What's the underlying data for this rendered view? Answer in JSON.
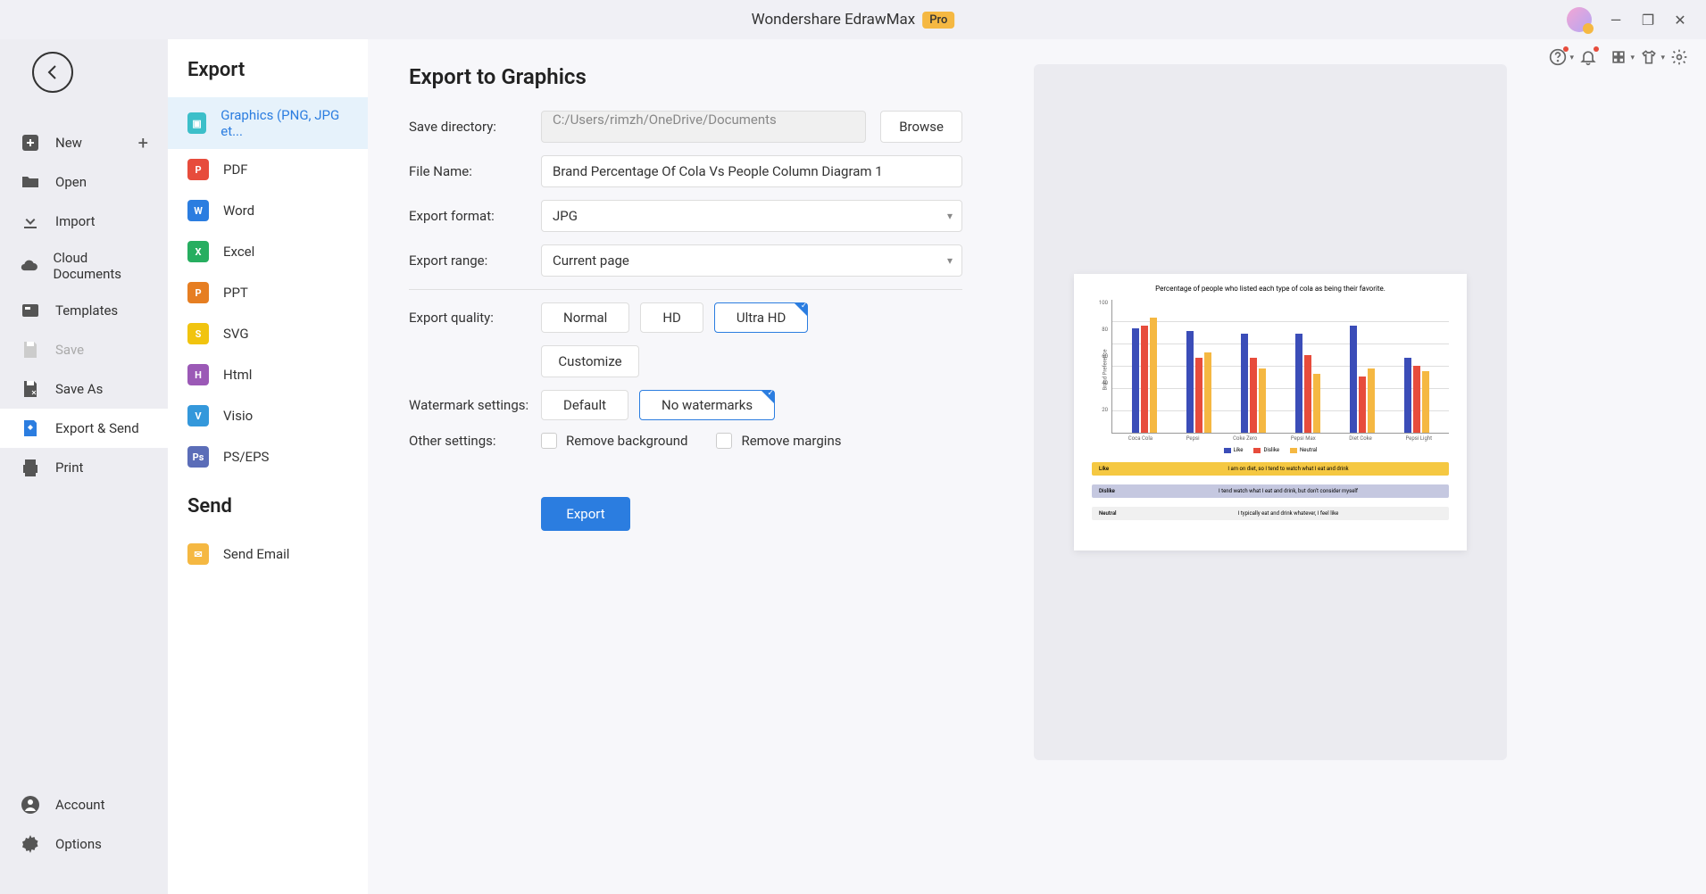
{
  "titlebar": {
    "app_name": "Wondershare EdrawMax",
    "pro_badge": "Pro"
  },
  "sidebar_left": {
    "items": [
      {
        "label": "New"
      },
      {
        "label": "Open"
      },
      {
        "label": "Import"
      },
      {
        "label": "Cloud Documents"
      },
      {
        "label": "Templates"
      },
      {
        "label": "Save"
      },
      {
        "label": "Save As"
      },
      {
        "label": "Export & Send"
      },
      {
        "label": "Print"
      }
    ],
    "bottom": [
      {
        "label": "Account"
      },
      {
        "label": "Options"
      }
    ]
  },
  "sidebar_mid": {
    "export_header": "Export",
    "export_items": [
      {
        "label": "Graphics (PNG, JPG et...",
        "color": "#3cbfc9"
      },
      {
        "label": "PDF",
        "color": "#e74c3c"
      },
      {
        "label": "Word",
        "color": "#2b7de0"
      },
      {
        "label": "Excel",
        "color": "#27ae60"
      },
      {
        "label": "PPT",
        "color": "#e67e22"
      },
      {
        "label": "SVG",
        "color": "#f1c40f"
      },
      {
        "label": "Html",
        "color": "#9b59b6"
      },
      {
        "label": "Visio",
        "color": "#3498db"
      },
      {
        "label": "PS/EPS",
        "color": "#5b6db8"
      }
    ],
    "send_header": "Send",
    "send_items": [
      {
        "label": "Send Email",
        "color": "#f5b842"
      }
    ]
  },
  "content": {
    "title": "Export to Graphics",
    "save_dir_label": "Save directory:",
    "save_dir_value": "C:/Users/rimzh/OneDrive/Documents",
    "browse_btn": "Browse",
    "filename_label": "File Name:",
    "filename_value": "Brand Percentage Of Cola Vs People Column Diagram 1",
    "format_label": "Export format:",
    "format_value": "JPG",
    "range_label": "Export range:",
    "range_value": "Current page",
    "quality_label": "Export quality:",
    "quality_options": [
      "Normal",
      "HD",
      "Ultra HD"
    ],
    "customize_btn": "Customize",
    "watermark_label": "Watermark settings:",
    "watermark_options": [
      "Default",
      "No watermarks"
    ],
    "other_label": "Other settings:",
    "remove_bg": "Remove background",
    "remove_margins": "Remove margins",
    "export_btn": "Export"
  },
  "preview": {
    "title": "Percentage of people who listed each type of cola as being their favorite.",
    "y_axis_label": "Brand Preference",
    "y_ticks": [
      "100",
      "80",
      "60",
      "40",
      "20"
    ],
    "categories": [
      "Coca Cola",
      "Pepsi",
      "Coke Zero",
      "Pepsi Max",
      "Diet Coke",
      "Pepsi Light"
    ],
    "series": [
      {
        "name": "Like",
        "color": "#3b4db8"
      },
      {
        "name": "Dislike",
        "color": "#e74c3c"
      },
      {
        "name": "Neutral",
        "color": "#f5b842"
      }
    ],
    "legend_prefix": "■",
    "desc": [
      {
        "label": "Like",
        "text": "I am on diet, so I tend to watch what I eat and drink",
        "bg": "#f5c842"
      },
      {
        "label": "Dislike",
        "text": "I tend watch what I eat and drink, but don't consider myself",
        "bg": "#c5c8e0"
      },
      {
        "label": "Neutral",
        "text": "I typically eat and drink whatever, I feel like",
        "bg": "#f0f0f0"
      }
    ]
  },
  "chart_data": {
    "type": "bar",
    "title": "Percentage of people who listed each type of cola as being their favorite.",
    "ylabel": "Brand Preference",
    "ylim": [
      0,
      100
    ],
    "categories": [
      "Coca Cola",
      "Pepsi",
      "Coke Zero",
      "Pepsi Max",
      "Diet Coke",
      "Pepsi Light"
    ],
    "series": [
      {
        "name": "Like",
        "values": [
          78,
          76,
          74,
          74,
          80,
          56
        ],
        "color": "#3b4db8"
      },
      {
        "name": "Dislike",
        "values": [
          80,
          56,
          56,
          58,
          42,
          50
        ],
        "color": "#e74c3c"
      },
      {
        "name": "Neutral",
        "values": [
          86,
          60,
          48,
          44,
          48,
          46
        ],
        "color": "#f5b842"
      }
    ]
  }
}
